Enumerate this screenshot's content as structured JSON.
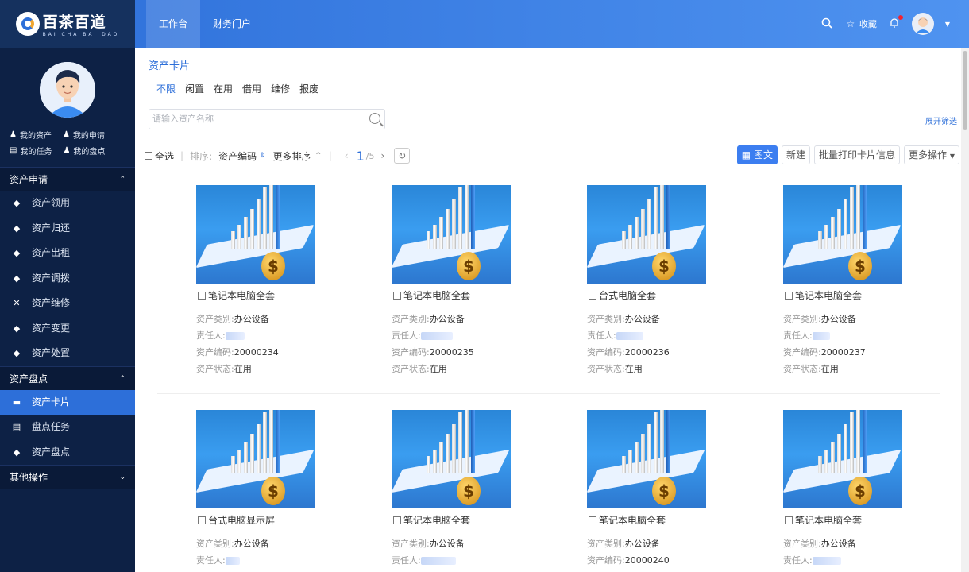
{
  "brand": {
    "name": "百茶百道",
    "subtitle": "BAI CHA BAI DAO"
  },
  "nav": {
    "tabs": [
      "工作台",
      "财务门户"
    ],
    "favorites_label": "收藏"
  },
  "sidebar": {
    "quick_links": [
      "我的资产",
      "我的申请",
      "我的任务",
      "我的盘点"
    ],
    "groups": [
      {
        "label": "资产申请",
        "items": [
          "资产领用",
          "资产归还",
          "资产出租",
          "资产调拨",
          "资产维修",
          "资产变更",
          "资产处置"
        ]
      },
      {
        "label": "资产盘点",
        "items": [
          "资产卡片",
          "盘点任务",
          "资产盘点"
        ]
      },
      {
        "label": "其他操作",
        "items": []
      }
    ],
    "active_item": "资产卡片"
  },
  "main": {
    "title": "资产卡片",
    "status_filters": [
      "不限",
      "闲置",
      "在用",
      "借用",
      "维修",
      "报废"
    ],
    "search_placeholder": "请输入资产名称",
    "expand_label": "展开筛选",
    "toolbar": {
      "select_all": "全选",
      "sort_label": "排序:",
      "sort_field": "资产编码",
      "more_sort": "更多排序",
      "page_current": "1",
      "page_total": "/5",
      "view_button": "图文",
      "new_button": "新建",
      "print_button": "批量打印卡片信息",
      "more_ops": "更多操作"
    },
    "field_labels": {
      "category": "资产类别:",
      "owner": "责任人:",
      "code": "资产编码:",
      "status": "资产状态:"
    },
    "cards": [
      {
        "name": "笔记本电脑全套",
        "category": "办公设备",
        "code": "20000234",
        "status": "在用"
      },
      {
        "name": "笔记本电脑全套",
        "category": "办公设备",
        "code": "20000235",
        "status": "在用"
      },
      {
        "name": "台式电脑全套",
        "category": "办公设备",
        "code": "20000236",
        "status": "在用"
      },
      {
        "name": "笔记本电脑全套",
        "category": "办公设备",
        "code": "20000237",
        "status": "在用"
      },
      {
        "name": "台式电脑显示屏",
        "category": "办公设备"
      },
      {
        "name": "笔记本电脑全套",
        "category": "办公设备"
      },
      {
        "name": "笔记本电脑全套",
        "category": "办公设备",
        "code": "20000240"
      },
      {
        "name": "笔记本电脑全套",
        "category": "办公设备"
      }
    ]
  }
}
